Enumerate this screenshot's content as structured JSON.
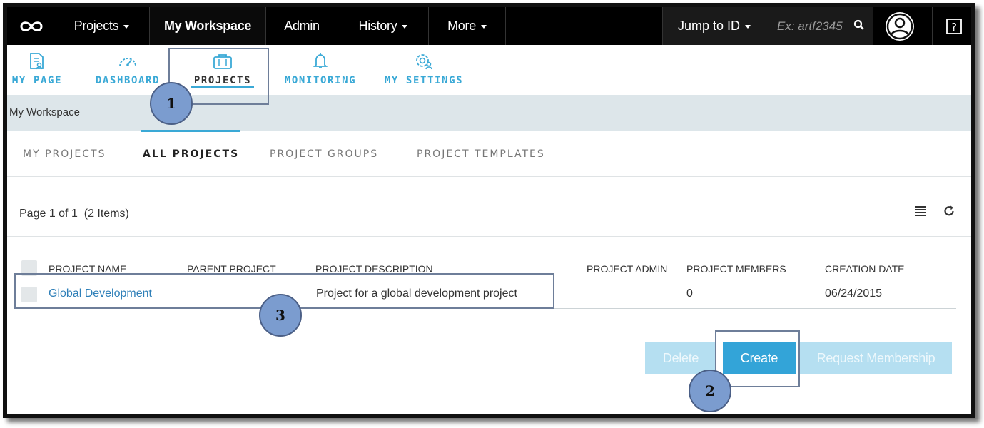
{
  "topnav": {
    "items": [
      {
        "label": "Projects"
      },
      {
        "label": "My Workspace"
      },
      {
        "label": "Admin"
      },
      {
        "label": "History"
      },
      {
        "label": "More"
      }
    ],
    "jump_label": "Jump to ID",
    "jump_placeholder": "Ex: artf2345"
  },
  "subnav": {
    "items": [
      {
        "label": "MY PAGE",
        "icon": "my-page-icon"
      },
      {
        "label": "DASHBOARD",
        "icon": "dashboard-icon"
      },
      {
        "label": "PROJECTS",
        "icon": "briefcase-icon"
      },
      {
        "label": "MONITORING",
        "icon": "bell-icon"
      },
      {
        "label": "MY SETTINGS",
        "icon": "settings-icon"
      }
    ],
    "active": "PROJECTS"
  },
  "breadcrumb": "My Workspace",
  "tabs": [
    {
      "label": "MY PROJECTS"
    },
    {
      "label": "ALL PROJECTS"
    },
    {
      "label": "PROJECT GROUPS"
    },
    {
      "label": "PROJECT TEMPLATES"
    }
  ],
  "active_tab": "ALL PROJECTS",
  "page_info": "Page 1 of 1  (2 Items)",
  "table": {
    "headers": [
      "PROJECT NAME",
      "PARENT PROJECT",
      "PROJECT DESCRIPTION",
      "PROJECT ADMIN",
      "PROJECT MEMBERS",
      "CREATION DATE"
    ],
    "rows": [
      {
        "name": "Global Development",
        "parent": "",
        "description": "Project for a global development project",
        "admin": "",
        "members": "0",
        "created": "06/24/2015"
      }
    ]
  },
  "buttons": {
    "delete": "Delete",
    "create": "Create",
    "request": "Request Membership"
  },
  "callouts": [
    "1",
    "2",
    "3"
  ],
  "colors": {
    "accent": "#33a4d8",
    "topnav_bg": "#000000",
    "link": "#2e7fb8",
    "callout": "#7b9ccf"
  }
}
